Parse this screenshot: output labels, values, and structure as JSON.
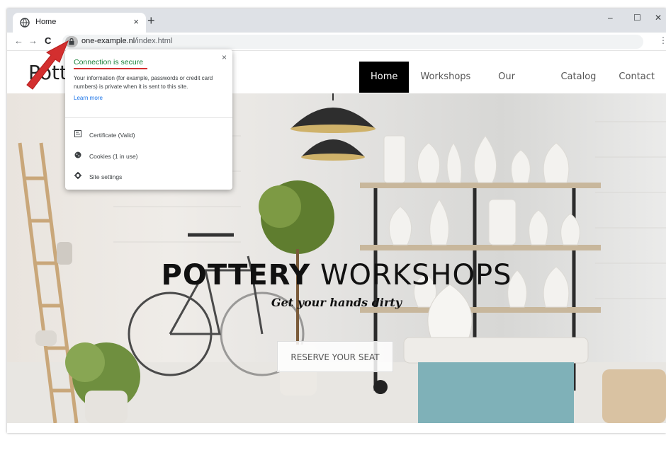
{
  "browser": {
    "tab_title": "Home",
    "tab_close": "×",
    "new_tab": "+",
    "window_controls": {
      "minimize": "–",
      "maximize": "☐",
      "close": "✕"
    },
    "nav": {
      "back": "←",
      "forward": "→",
      "reload": "C"
    },
    "url_host": "one-example.nl",
    "url_path": "/index.html",
    "star": "☆",
    "menu": "⋮"
  },
  "site": {
    "logo": "Pott",
    "nav": [
      {
        "label": "Home",
        "active": true
      },
      {
        "label": "Workshops ⌄",
        "active": false
      },
      {
        "label": "Our Story",
        "active": false
      },
      {
        "label": "Catalog",
        "active": false
      },
      {
        "label": "Contact",
        "active": false
      }
    ]
  },
  "hero": {
    "title_bold": "POTTERY",
    "title_light": " WORKSHOPS",
    "subtitle": "Get your hands dirty",
    "button": "RESERVE YOUR SEAT"
  },
  "security_popup": {
    "close": "×",
    "title": "Connection is secure",
    "description": "Your information (for example, passwords or credit card numbers) is private when it is sent to this site.",
    "link": "Learn more",
    "rows": [
      {
        "icon": "certificate-icon",
        "label": "Certificate (Valid)"
      },
      {
        "icon": "cookie-icon",
        "label": "Cookies (1 in use)"
      },
      {
        "icon": "gear-icon",
        "label": "Site settings"
      }
    ]
  },
  "colors": {
    "secure_green": "#188038",
    "link_blue": "#1a73e8",
    "annotation_red": "#d32f2f",
    "nav_active_bg": "#000000"
  }
}
